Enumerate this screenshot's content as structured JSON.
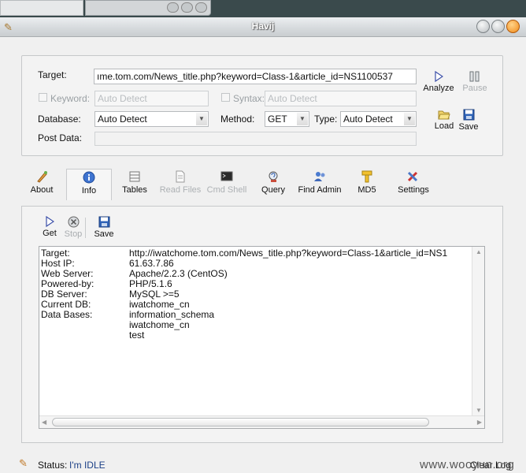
{
  "app": {
    "title": "Havij"
  },
  "form": {
    "target_label": "Target:",
    "target_value": "ıme.tom.com/News_title.php?keyword=Class-1&article_id=NS1100537",
    "keyword_label": "Keyword:",
    "keyword_placeholder": "Auto Detect",
    "syntax_label": "Syntax:",
    "syntax_placeholder": "Auto Detect",
    "database_label": "Database:",
    "database_value": "Auto Detect",
    "method_label": "Method:",
    "method_value": "GET",
    "type_label": "Type:",
    "type_value": "Auto Detect",
    "postdata_label": "Post Data:"
  },
  "actions": {
    "analyze": "Analyze",
    "pause": "Pause",
    "load": "Load",
    "save": "Save"
  },
  "tabs": [
    {
      "label": "About",
      "icon": "about-icon",
      "state": "normal"
    },
    {
      "label": "Info",
      "icon": "info-icon",
      "state": "selected"
    },
    {
      "label": "Tables",
      "icon": "tables-icon",
      "state": "normal"
    },
    {
      "label": "Read Files",
      "icon": "read-files-icon",
      "state": "disabled"
    },
    {
      "label": "Cmd Shell",
      "icon": "cmd-shell-icon",
      "state": "disabled"
    },
    {
      "label": "Query",
      "icon": "query-icon",
      "state": "normal"
    },
    {
      "label": "Find Admin",
      "icon": "find-admin-icon",
      "state": "normal"
    },
    {
      "label": "MD5",
      "icon": "md5-icon",
      "state": "normal"
    },
    {
      "label": "Settings",
      "icon": "settings-icon",
      "state": "normal"
    }
  ],
  "subtoolbar": {
    "get": "Get",
    "stop": "Stop",
    "save": "Save"
  },
  "results": {
    "rows": [
      {
        "key": "Target:",
        "value": "http://iwatchome.tom.com/News_title.php?keyword=Class-1&article_id=NS1"
      },
      {
        "key": "Host IP:",
        "value": "61.63.7.86"
      },
      {
        "key": "Web Server:",
        "value": "Apache/2.2.3 (CentOS)"
      },
      {
        "key": "Powered-by:",
        "value": "PHP/5.1.6"
      },
      {
        "key": "DB Server:",
        "value": "MySQL >=5"
      },
      {
        "key": "Current DB:",
        "value": "iwatchome_cn"
      },
      {
        "key": "Data Bases:",
        "value": "information_schema"
      },
      {
        "key": "",
        "value": "iwatchome_cn"
      },
      {
        "key": "",
        "value": "test"
      }
    ]
  },
  "status": {
    "label": "Status:",
    "value": "I'm IDLE",
    "clear_log": "Clear Log"
  },
  "watermark": "www.wooyun.org"
}
